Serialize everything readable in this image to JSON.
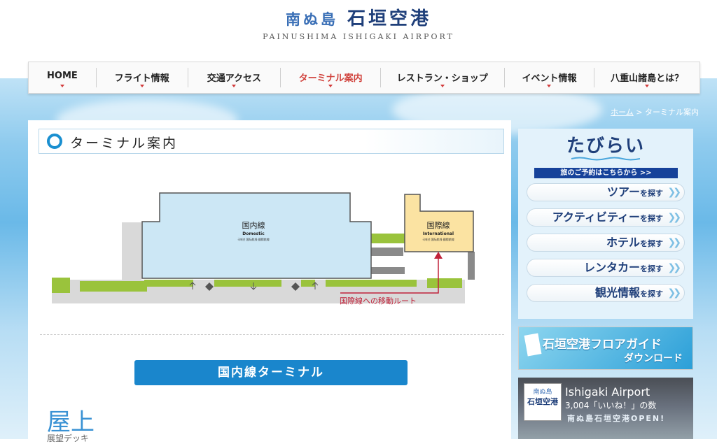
{
  "logo": {
    "prefix": "南ぬ島",
    "name": "石垣空港",
    "english": "PAINUSHIMA ISHIGAKI AIRPORT"
  },
  "nav": {
    "items": [
      {
        "label": "HOME"
      },
      {
        "label": "フライト情報"
      },
      {
        "label": "交通アクセス"
      },
      {
        "label": "ターミナル案内"
      },
      {
        "label": "レストラン・ショップ"
      },
      {
        "label": "イベント情報"
      },
      {
        "label": "八重山諸島とは？"
      }
    ]
  },
  "breadcrumb": {
    "home": "ホーム",
    "separator": ">",
    "current": "ターミナル案内"
  },
  "page": {
    "title": "ターミナル案内"
  },
  "map": {
    "domestic_jp": "国内線",
    "domestic_en": "Domestic",
    "domestic_sub": "국제선  国际航线  國際航線",
    "intl_jp": "国際線",
    "intl_en": "International",
    "intl_sub": "국제선  国际航线  國際航線",
    "route_label": "国際線への移動ルート"
  },
  "terminal_button": "国内線ターミナル",
  "floor": {
    "title": "屋上",
    "subtitle": "展望デッキ"
  },
  "sidebar": {
    "brand": "たびらい",
    "tagline": "旅のご予約はこちらから >>",
    "buttons": [
      {
        "main": "ツアー",
        "suffix": "を探す"
      },
      {
        "main": "アクティビティー",
        "suffix": "を探す"
      },
      {
        "main": "ホテル",
        "suffix": "を探す"
      },
      {
        "main": "レンタカー",
        "suffix": "を探す"
      },
      {
        "main": "観光情報",
        "suffix": "を探す"
      }
    ],
    "guide_line1": "石垣空港フロアガイド",
    "guide_line2": "ダウンロード",
    "fb": {
      "thumb_a": "南ぬ島",
      "thumb_b": "石垣空港",
      "name": "Ishigaki Airport",
      "likes": "3,004「いいね！」の数",
      "open": "南ぬ島石垣空港OPEN!"
    }
  },
  "colors": {
    "accent": "#1a86cc",
    "navy": "#1f3f7a",
    "nav_active": "#d0403a"
  }
}
